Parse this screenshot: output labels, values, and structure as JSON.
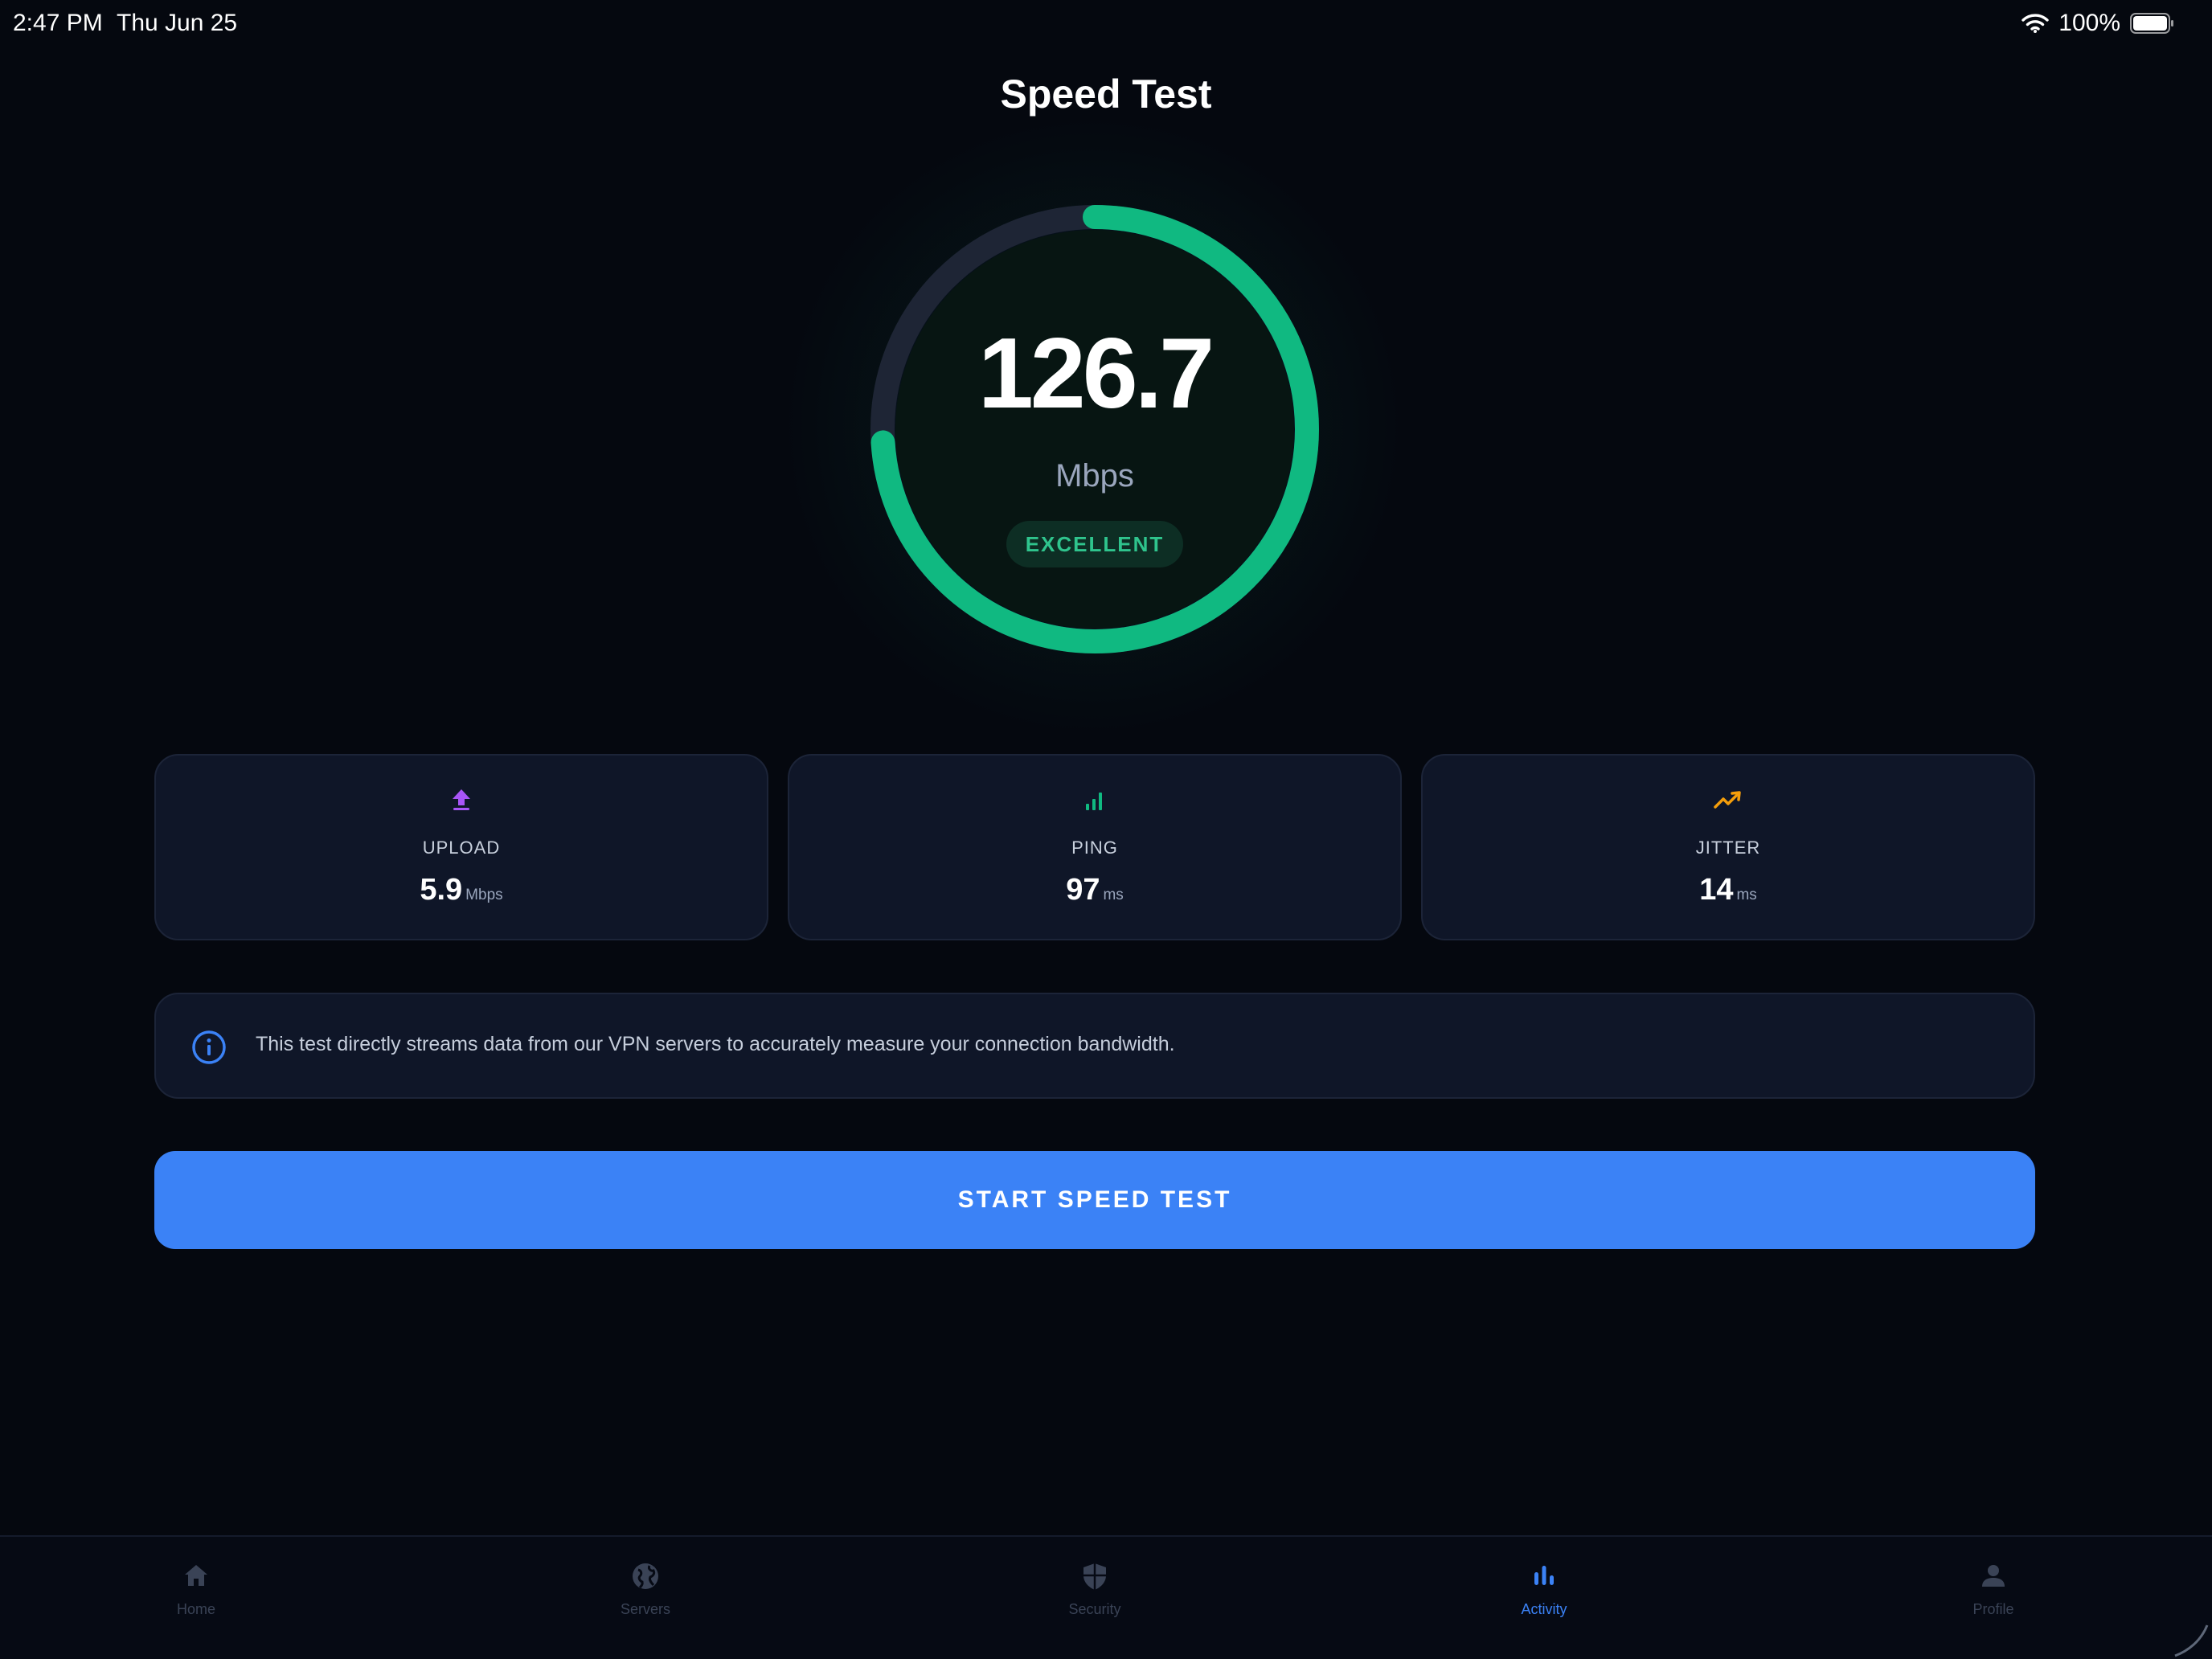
{
  "status_bar": {
    "time": "2:47 PM",
    "date": "Thu Jun 25",
    "battery": "100%"
  },
  "title": "Speed Test",
  "gauge": {
    "value": "126.7",
    "unit": "Mbps",
    "rating": "EXCELLENT",
    "fill_fraction": 0.74,
    "colors": {
      "arc": "#10b981",
      "track": "#1e2535",
      "inner": "#071512"
    }
  },
  "stats": [
    {
      "icon": "upload-icon",
      "label": "UPLOAD",
      "value": "5.9",
      "unit": "Mbps",
      "color": "#a855f7"
    },
    {
      "icon": "signal-icon",
      "label": "PING",
      "value": "97",
      "unit": "ms",
      "color": "#10b981"
    },
    {
      "icon": "trend-icon",
      "label": "JITTER",
      "value": "14",
      "unit": "ms",
      "color": "#f59e0b"
    }
  ],
  "info": {
    "icon": "info-icon",
    "text": "This test directly streams data from our VPN servers to accurately measure your connection bandwidth."
  },
  "start_button": {
    "label": "START SPEED TEST"
  },
  "tabs": [
    {
      "icon": "home-icon",
      "label": "Home",
      "active": false
    },
    {
      "icon": "globe-icon",
      "label": "Servers",
      "active": false
    },
    {
      "icon": "shield-icon",
      "label": "Security",
      "active": false
    },
    {
      "icon": "bar-chart-icon",
      "label": "Activity",
      "active": true
    },
    {
      "icon": "person-icon",
      "label": "Profile",
      "active": false
    }
  ],
  "colors": {
    "background": "#05080f",
    "card": "#0f1628",
    "accent": "#3b82f6",
    "success": "#10b981"
  }
}
